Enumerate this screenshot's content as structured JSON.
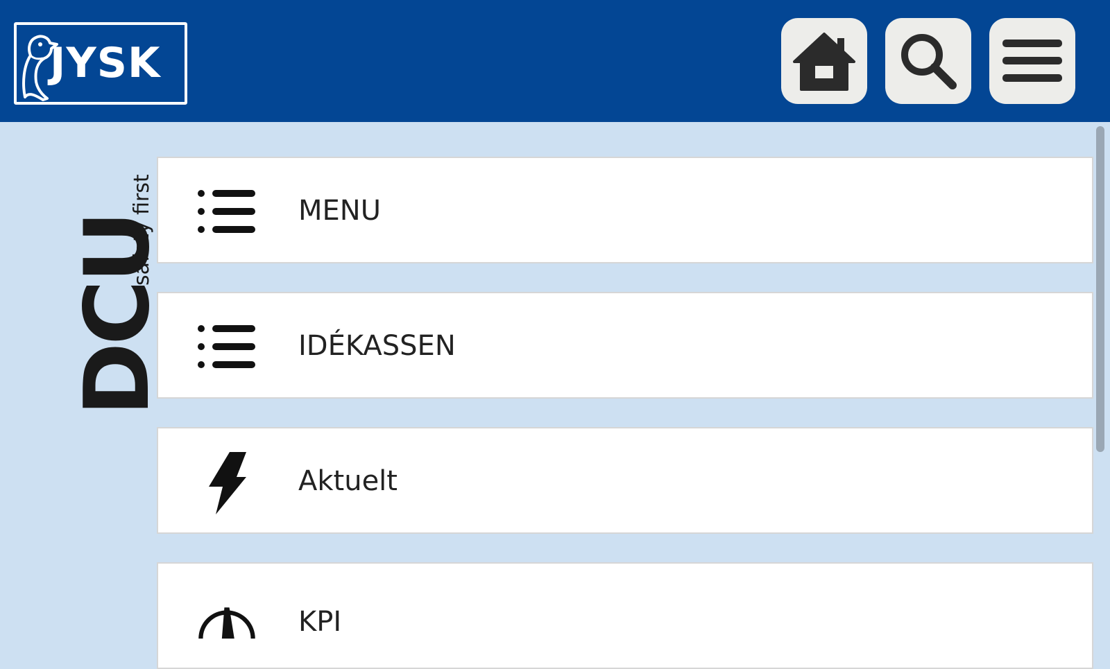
{
  "header": {
    "logo_text": "JYSK",
    "home_icon": "home-icon",
    "search_icon": "search-icon",
    "menu_icon": "hamburger-menu-icon",
    "background_color": "#034694"
  },
  "brand": {
    "title": "DCU",
    "tagline": "safety first"
  },
  "menu_items": [
    {
      "label": "MENU",
      "icon": "list-icon"
    },
    {
      "label": "IDÉKASSEN",
      "icon": "list-icon"
    },
    {
      "label": "Aktuelt",
      "icon": "lightning-icon"
    },
    {
      "label": "KPI",
      "icon": "gauge-icon"
    }
  ],
  "colors": {
    "page_background": "#cde0f2",
    "card_background": "#ffffff",
    "header_button": "#ededea"
  }
}
